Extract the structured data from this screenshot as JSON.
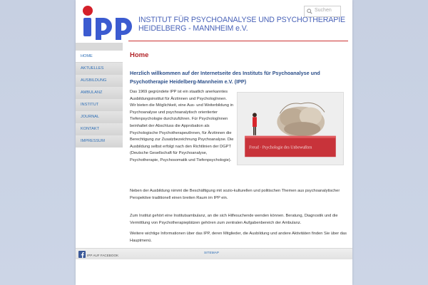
{
  "header": {
    "logo_text": "ipp",
    "institute_line1": "INSTITUT FÜR PSYCHOANALYSE UND PSYCHOTHERAPIE",
    "institute_line2": "HEIDELBERG - MANNHEIM e.V."
  },
  "search": {
    "placeholder": "Suchen"
  },
  "nav": {
    "items": [
      {
        "label": "HOME"
      },
      {
        "label": "AKTUELLES"
      },
      {
        "label": "AUSBILDUNG"
      },
      {
        "label": "AMBULANZ"
      },
      {
        "label": "INSTITUT"
      },
      {
        "label": "JOURNAL"
      },
      {
        "label": "KONTAKT"
      },
      {
        "label": "IMPRESSUM"
      }
    ]
  },
  "content": {
    "page_title": "Home",
    "welcome": "Herzlich willkommen auf der Internetseite des Instituts für Psychoanalyse und Psychotherapie Heidelberg-Mannheim e.V. (IPP)",
    "p1": "Das 1969 gegründete IPP ist ein staatlich anerkanntes Ausbildungsinstitut für Ärztinnen und PsychologInnen. Wir bieten die Möglichkeit, eine Aus- und Weiterbildung in Psychoanalyse und psychoanalytisch orientierter Tiefenpsychologie durchzuführen. Für PsychologInnen beinhaltet der Abschluss die Approbation als Psychologische PsychotherapeutInnen, für Ärztinnen die Berechtigung zur Zusatzbezeichnung Psychoanalyse. Die Ausbildung selbst erfolgt nach den Richtlinien der DGPT (Deutsche Gesellschaft für Psychoanalyse, Psychotherapie, Psychosomatik und Tiefenpsychologie).",
    "p2": "Neben der Ausbildung nimmt die Beschäftigung mit sozio-kulturellen und politischen Themen aus psychoanalytischer Perspektive traditionell einen breiten Raum im IPP ein.",
    "p3": "Zum Institut gehört eine Institutsambulanz, an die sich Hilfesuchende wenden können. Beratung, Diagnostik und die Vermittlung von Psychotherapieplätzen gehören zum zentralen Aufgabenbereich der Ambulanz.",
    "p4": "Weitere wichtige Informationen über das IPP, deren Mitglieder, die Ausbildung und andere Aktivitäten finden Sie über das Hauptmenü.",
    "book_title": "Freud · Psychologie des Unbewußten"
  },
  "footer": {
    "facebook_label": "IPP AUF FACEBOOK",
    "sitemap_label": "SITEMAP"
  },
  "colors": {
    "accent_red": "#b2262a",
    "link_blue": "#2f6fb6",
    "logo_blue": "#4a63b8"
  }
}
